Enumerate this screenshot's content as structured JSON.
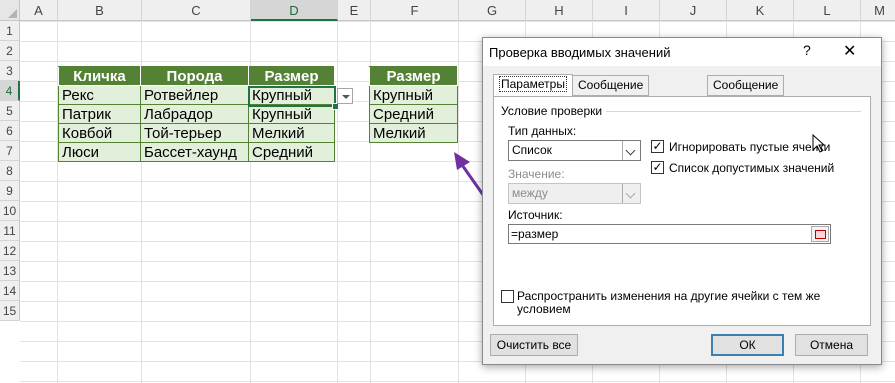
{
  "columns": [
    "A",
    "B",
    "C",
    "D",
    "E",
    "F",
    "G",
    "H",
    "I",
    "J",
    "K",
    "L",
    "M"
  ],
  "rows": [
    "1",
    "2",
    "3",
    "4",
    "5",
    "6",
    "7",
    "8",
    "9",
    "10",
    "11",
    "12",
    "13",
    "14",
    "15"
  ],
  "selected_column": "D",
  "selected_row": "4",
  "table_pets": {
    "headers": [
      "Кличка",
      "Порода",
      "Размер"
    ],
    "rows": [
      [
        "Рекс",
        "Ротвейлер",
        "Крупный"
      ],
      [
        "Патрик",
        "Лабрадор",
        "Крупный"
      ],
      [
        "Ковбой",
        "Той-терьер",
        "Мелкий"
      ],
      [
        "Люси",
        "Бассет-хаунд",
        "Средний"
      ]
    ]
  },
  "table_sizes": {
    "header": "Размер",
    "items": [
      "Крупный",
      "Средний",
      "Мелкий"
    ]
  },
  "colors": {
    "header_green": "#548235",
    "cell_green": "#e2efda",
    "excel_green": "#217346",
    "arrow_purple": "#7030a0"
  },
  "dialog": {
    "title": "Проверка вводимых значений",
    "help": "?",
    "close": "✕",
    "tabs": [
      "Параметры",
      "Сообщение для ввода",
      "Сообщение об ошибке"
    ],
    "group_label": "Условие проверки",
    "data_type_label": "Тип данных:",
    "data_type_value": "Список",
    "value_label": "Значение:",
    "value_value": "между",
    "ignore_blank_label": "Игнорировать пустые ячейки",
    "ignore_blank_checked": true,
    "dropdown_label": "Список допустимых значений",
    "dropdown_checked": true,
    "source_label": "Источник:",
    "source_value": "=размер",
    "apply_all_label": "Распространить изменения на другие ячейки с тем же условием",
    "apply_all_checked": false,
    "clear_all": "Очистить все",
    "ok": "ОК",
    "cancel": "Отмена"
  }
}
